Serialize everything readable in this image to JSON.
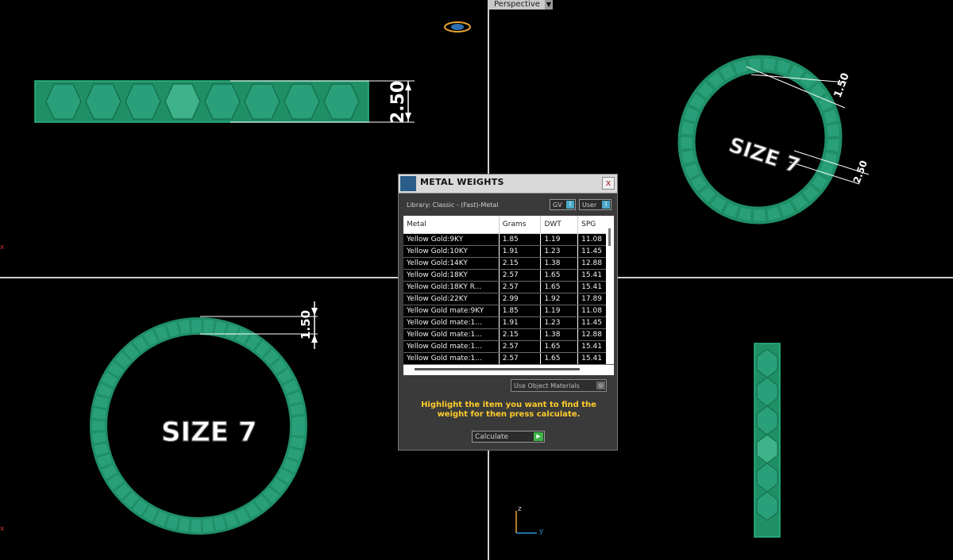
{
  "viewport": {
    "label": "Perspective",
    "dropdown_icon": "dropdown-arrow-icon"
  },
  "axes": {
    "x": "x",
    "z": "z",
    "y": "y"
  },
  "annotations": {
    "front_dim": "2.50",
    "top_dim": "1.50",
    "persp_dim1": "1.50",
    "persp_dim2": "2.50",
    "size_top": "SIZE 7",
    "size_persp": "SIZE 7"
  },
  "dialog": {
    "title": "METAL WEIGHTS",
    "close": "x",
    "library": "Library: Classic - (Fast)-Metal",
    "toggles": [
      {
        "label": "GV",
        "ind": "I"
      },
      {
        "label": "User",
        "ind": "I"
      }
    ],
    "columns": [
      "Metal",
      "Grams",
      "DWT",
      "SPG"
    ],
    "rows": [
      [
        "Yellow Gold:9KY",
        "1.85",
        "1.19",
        "11.08"
      ],
      [
        "Yellow Gold:10KY",
        "1.91",
        "1.23",
        "11.45"
      ],
      [
        "Yellow Gold:14KY",
        "2.15",
        "1.38",
        "12.88"
      ],
      [
        "Yellow Gold:18KY",
        "2.57",
        "1.65",
        "15.41"
      ],
      [
        "Yellow Gold:18KY R...",
        "2.57",
        "1.65",
        "15.41"
      ],
      [
        "Yellow Gold:22KY",
        "2.99",
        "1.92",
        "17.89"
      ],
      [
        "Yellow Gold mate:9KY",
        "1.85",
        "1.19",
        "11.08"
      ],
      [
        "Yellow Gold mate:1...",
        "1.91",
        "1.23",
        "11.45"
      ],
      [
        "Yellow Gold mate:1...",
        "2.15",
        "1.38",
        "12.88"
      ],
      [
        "Yellow Gold mate:1...",
        "2.57",
        "1.65",
        "15.41"
      ],
      [
        "Yellow Gold mate:1...",
        "2.57",
        "1.65",
        "15.41"
      ]
    ],
    "use_object_materials": "Use Object Materials",
    "message": "Highlight the item you want to find the weight for then press calculate.",
    "calculate": "Calculate"
  },
  "colors": {
    "ring_green": "#1f8f66",
    "message_yellow": "#ffcc2b"
  }
}
